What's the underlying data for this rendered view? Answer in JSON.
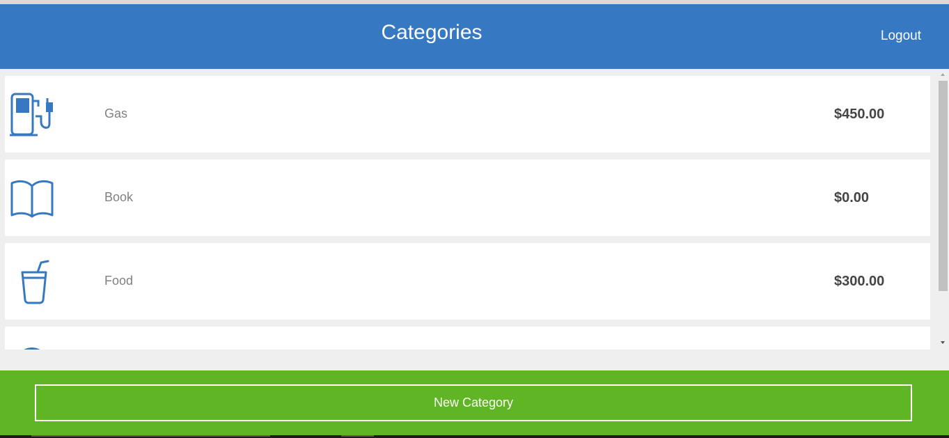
{
  "header": {
    "title": "Categories",
    "logout_label": "Logout"
  },
  "categories": [
    {
      "name": "Gas",
      "amount": "$450.00",
      "icon": "gas-pump-icon"
    },
    {
      "name": "Book",
      "amount": "$0.00",
      "icon": "book-icon"
    },
    {
      "name": "Food",
      "amount": "$300.00",
      "icon": "cup-icon"
    },
    {
      "name": "",
      "amount": "",
      "icon": "circle-icon"
    }
  ],
  "footer": {
    "new_category_label": "New Category"
  },
  "colors": {
    "header": "#3678c2",
    "footer": "#5fb523",
    "icon": "#3678c2"
  }
}
